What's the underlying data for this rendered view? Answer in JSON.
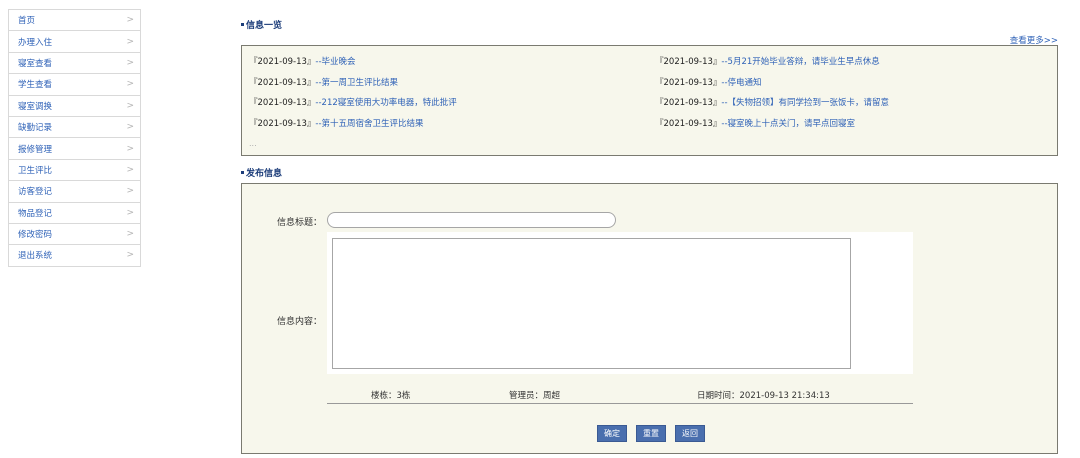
{
  "sidebar": {
    "items": [
      {
        "label": "首页"
      },
      {
        "label": "办理入住"
      },
      {
        "label": "寝室查看"
      },
      {
        "label": "学生查看"
      },
      {
        "label": "寝室调换"
      },
      {
        "label": "缺勤记录"
      },
      {
        "label": "报修管理"
      },
      {
        "label": "卫生评比"
      },
      {
        "label": "访客登记"
      },
      {
        "label": "物品登记"
      },
      {
        "label": "修改密码"
      },
      {
        "label": "退出系统"
      }
    ],
    "chevron": ">"
  },
  "news": {
    "heading": "信息一览",
    "more_label": "查看更多>>",
    "left": [
      {
        "date": "『2021-09-13』",
        "sep": "--",
        "title": "毕业晚会"
      },
      {
        "date": "『2021-09-13』",
        "sep": "--",
        "title": "第一周卫生评比结果"
      },
      {
        "date": "『2021-09-13』",
        "sep": "--",
        "title": "212寝室使用大功率电器，特此批评"
      },
      {
        "date": "『2021-09-13』",
        "sep": "--",
        "title": "第十五周宿舍卫生评比结果"
      }
    ],
    "right": [
      {
        "date": "『2021-09-13』",
        "sep": "--",
        "title": "5月21开始毕业答辩，请毕业生早点休息"
      },
      {
        "date": "『2021-09-13』",
        "sep": "--",
        "title": "停电通知"
      },
      {
        "date": "『2021-09-13』",
        "sep": "--",
        "title": "【失物招领】有同学捡到一张饭卡，请留意"
      },
      {
        "date": "『2021-09-13』",
        "sep": "--",
        "title": "寝室晚上十点关门，请早点回寝室"
      }
    ],
    "ellipsis": "..."
  },
  "publish": {
    "heading": "发布信息",
    "title_label": "信息标题：",
    "title_value": "",
    "content_label": "信息内容：",
    "content_value": "",
    "building": "楼栋：3栋",
    "manager": "管理员：周超",
    "datetime": "日期时间：2021-09-13 21:34:13",
    "buttons": {
      "confirm": "确定",
      "reset": "重置",
      "back": "返回"
    }
  },
  "colors": {
    "accent": "#2f62b7",
    "panel_bg": "#f7f7ec",
    "button": "#4a6fae"
  }
}
